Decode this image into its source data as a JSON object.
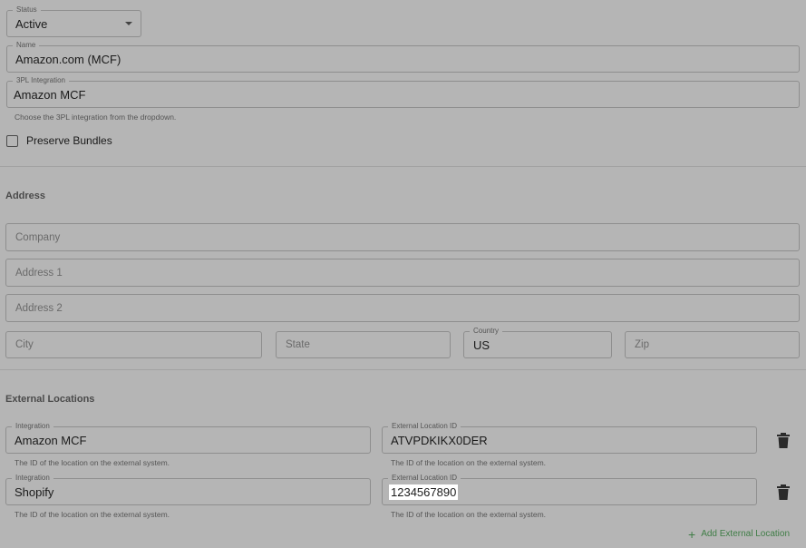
{
  "status": {
    "label": "Status",
    "value": "Active"
  },
  "name": {
    "label": "Name",
    "value": "Amazon.com (MCF)"
  },
  "integration": {
    "label": "3PL Integration",
    "value": "Amazon MCF",
    "helper": "Choose the 3PL integration from the dropdown."
  },
  "preserve_bundles": {
    "label": "Preserve Bundles",
    "checked": false
  },
  "address": {
    "title": "Address",
    "company_placeholder": "Company",
    "address1_placeholder": "Address 1",
    "address2_placeholder": "Address 2",
    "city_placeholder": "City",
    "state_placeholder": "State",
    "country": {
      "label": "Country",
      "value": "US"
    },
    "zip_placeholder": "Zip"
  },
  "external_locations": {
    "title": "External Locations",
    "rows": [
      {
        "integration_label": "Integration",
        "integration_value": "Amazon MCF",
        "integration_helper": "The ID of the location on the external system.",
        "location_label": "External Location ID",
        "location_value": "ATVPDKIKX0DER",
        "location_helper": "The ID of the location on the external system."
      },
      {
        "integration_label": "Integration",
        "integration_value": "Shopify",
        "integration_helper": "The ID of the location on the external system.",
        "location_label": "External Location ID",
        "location_value": "1234567890",
        "location_helper": "The ID of the location on the external system."
      }
    ],
    "add_label": "Add External Location"
  },
  "icons": {
    "delete": "trash-icon",
    "add": "plus-icon",
    "dropdown": "caret-down-icon"
  },
  "colors": {
    "background": "#b5b5b5",
    "accent": "#3f7d46"
  }
}
